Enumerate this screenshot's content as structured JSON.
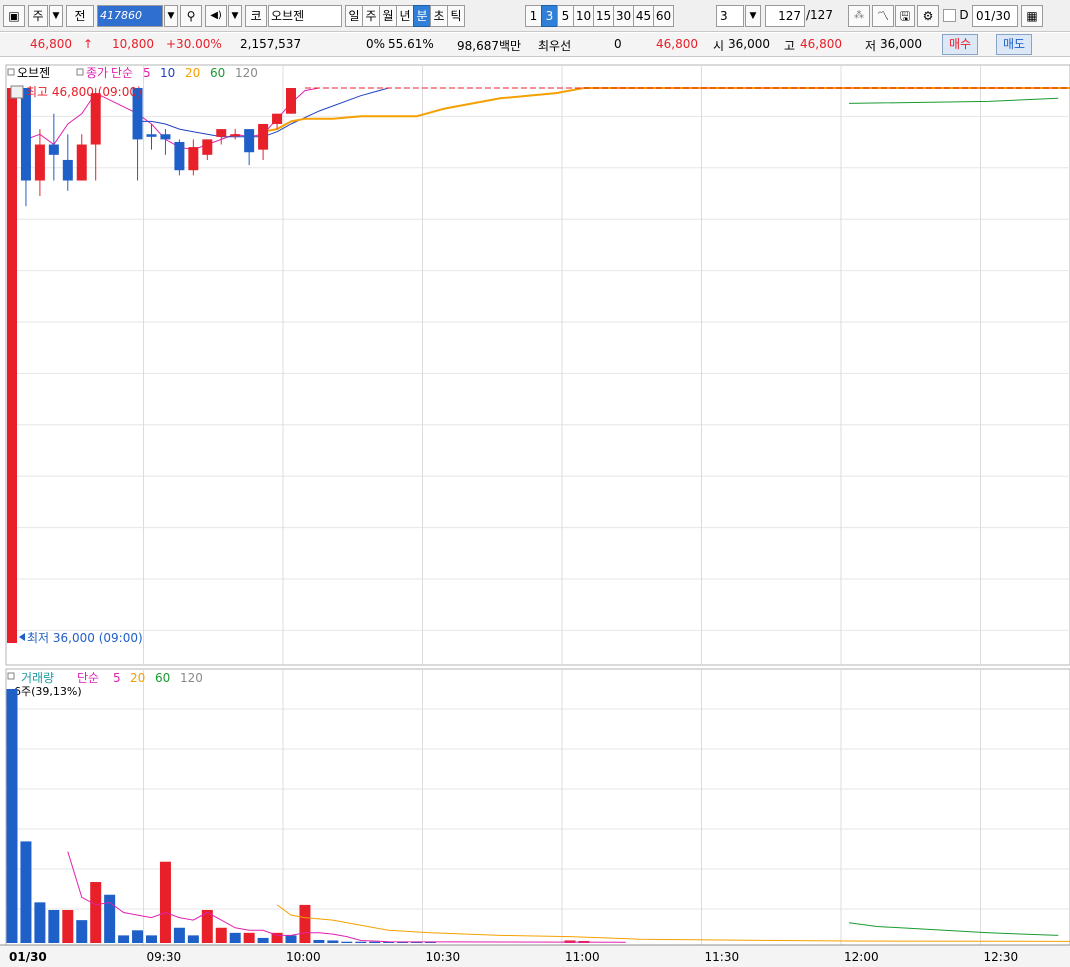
{
  "toolbar": {
    "type_label": "주",
    "prev_label": "전",
    "stock_code": "417860",
    "market_label": "코",
    "stock_name": "오브젠",
    "period_buttons": [
      "일",
      "주",
      "월",
      "년",
      "분",
      "초",
      "틱"
    ],
    "selected_period": "분",
    "interval_buttons": [
      "1",
      "3",
      "5",
      "10",
      "15",
      "30",
      "45",
      "60"
    ],
    "selected_interval": "3",
    "interval_value": "3",
    "count_value": "127",
    "count_total": "/127",
    "d_label": "D",
    "date_value": "01/30"
  },
  "quote": {
    "price": "46,800",
    "arrow": "↑",
    "change": "10,800",
    "change_pct": "+30.00%",
    "volume": "2,157,537",
    "turnover_label": "0%",
    "turnover_value": "55.61%",
    "amount": "98,687백만",
    "best_label": "최우선",
    "best_value": "0",
    "best_price": "46,800",
    "open_label": "시",
    "open_value": "36,000",
    "high_label": "고",
    "high_value": "46,800",
    "low_label": "저",
    "low_value": "36,000",
    "buy_label": "매수",
    "sell_label": "매도"
  },
  "colors": {
    "up": "#e8202a",
    "down": "#1f5fc8",
    "ma5": "#e020b0",
    "ma10": "#2040c0",
    "ma20": "#f5a000",
    "ma60": "#1a9a30",
    "ma120": "#8a8a8a"
  },
  "chart_data": [
    {
      "type": "candlestick",
      "title": "오브젠",
      "legend": {
        "price_label": "종가",
        "method": "단순",
        "periods": [
          "5",
          "10",
          "20",
          "60",
          "120"
        ]
      },
      "annotations": {
        "high": "최고 46,800 (09:00)",
        "low": "최저 36,000 (09:00)"
      },
      "ylim": [
        36000,
        46800
      ],
      "x_tick_labels": [
        "01/30",
        "09:30",
        "10:00",
        "10:30",
        "11:00",
        "11:30",
        "12:00",
        "12:30"
      ],
      "candles": [
        {
          "t": "09:00",
          "o": 36000,
          "h": 46800,
          "l": 36000,
          "c": 46800
        },
        {
          "t": "09:03",
          "o": 46800,
          "h": 46800,
          "l": 44500,
          "c": 45000
        },
        {
          "t": "09:06",
          "o": 45000,
          "h": 46000,
          "l": 44700,
          "c": 45700
        },
        {
          "t": "09:09",
          "o": 45700,
          "h": 46300,
          "l": 45000,
          "c": 45500
        },
        {
          "t": "09:12",
          "o": 45400,
          "h": 45900,
          "l": 44800,
          "c": 45000
        },
        {
          "t": "09:15",
          "o": 45000,
          "h": 45900,
          "l": 45000,
          "c": 45700
        },
        {
          "t": "09:18",
          "o": 45700,
          "h": 46800,
          "l": 45000,
          "c": 46700
        },
        {
          "t": "09:27",
          "o": 46800,
          "h": 46800,
          "l": 45000,
          "c": 45800
        },
        {
          "t": "09:30",
          "o": 45900,
          "h": 46100,
          "l": 45600,
          "c": 45850
        },
        {
          "t": "09:33",
          "o": 45900,
          "h": 46000,
          "l": 45500,
          "c": 45800
        },
        {
          "t": "09:36",
          "o": 45750,
          "h": 45800,
          "l": 45100,
          "c": 45200
        },
        {
          "t": "09:39",
          "o": 45200,
          "h": 45800,
          "l": 45100,
          "c": 45650
        },
        {
          "t": "09:42",
          "o": 45500,
          "h": 45800,
          "l": 45400,
          "c": 45800
        },
        {
          "t": "09:45",
          "o": 45850,
          "h": 46000,
          "l": 45700,
          "c": 46000
        },
        {
          "t": "09:48",
          "o": 45900,
          "h": 46000,
          "l": 45800,
          "c": 45900
        },
        {
          "t": "09:51",
          "o": 46000,
          "h": 46000,
          "l": 45300,
          "c": 45550
        },
        {
          "t": "09:54",
          "o": 45600,
          "h": 46100,
          "l": 45400,
          "c": 46100
        },
        {
          "t": "09:57",
          "o": 46100,
          "h": 46300,
          "l": 46000,
          "c": 46300
        },
        {
          "t": "10:00",
          "o": 46300,
          "h": 46800,
          "l": 46300,
          "c": 46800
        }
      ]
    },
    {
      "type": "bar",
      "title": "거래량",
      "legend": {
        "method": "단순",
        "periods": [
          "5",
          "20",
          "60",
          "120"
        ]
      },
      "max_label": "6주(39,13%)",
      "values": [
        {
          "t": "09:00",
          "v": 100,
          "up": false
        },
        {
          "t": "09:03",
          "v": 40,
          "up": false
        },
        {
          "t": "09:06",
          "v": 16,
          "up": false
        },
        {
          "t": "09:09",
          "v": 13,
          "up": false
        },
        {
          "t": "09:12",
          "v": 13,
          "up": true
        },
        {
          "t": "09:15",
          "v": 9,
          "up": false
        },
        {
          "t": "09:18",
          "v": 24,
          "up": true
        },
        {
          "t": "09:21",
          "v": 19,
          "up": false
        },
        {
          "t": "09:24",
          "v": 3,
          "up": false
        },
        {
          "t": "09:27",
          "v": 5,
          "up": false
        },
        {
          "t": "09:30",
          "v": 3,
          "up": false
        },
        {
          "t": "09:33",
          "v": 32,
          "up": true
        },
        {
          "t": "09:36",
          "v": 6,
          "up": false
        },
        {
          "t": "09:39",
          "v": 3,
          "up": false
        },
        {
          "t": "09:42",
          "v": 13,
          "up": true
        },
        {
          "t": "09:45",
          "v": 6,
          "up": true
        },
        {
          "t": "09:48",
          "v": 4,
          "up": false
        },
        {
          "t": "09:51",
          "v": 4,
          "up": true
        },
        {
          "t": "09:54",
          "v": 2,
          "up": false
        },
        {
          "t": "09:57",
          "v": 4,
          "up": true
        },
        {
          "t": "10:00",
          "v": 3,
          "up": false
        },
        {
          "t": "10:03",
          "v": 15,
          "up": true
        },
        {
          "t": "10:06",
          "v": 1.2,
          "up": false
        },
        {
          "t": "10:09",
          "v": 1,
          "up": false
        },
        {
          "t": "10:12",
          "v": 0.5,
          "up": false
        },
        {
          "t": "10:15",
          "v": 0.5,
          "up": false
        },
        {
          "t": "10:18",
          "v": 0.5,
          "up": false
        },
        {
          "t": "10:21",
          "v": 0.5,
          "up": false
        },
        {
          "t": "10:24",
          "v": 0.5,
          "up": false
        },
        {
          "t": "10:27",
          "v": 0.5,
          "up": false
        },
        {
          "t": "10:30",
          "v": 0.5,
          "up": false
        },
        {
          "t": "11:00",
          "v": 1,
          "up": true
        },
        {
          "t": "11:03",
          "v": 0.8,
          "up": true
        }
      ]
    }
  ]
}
